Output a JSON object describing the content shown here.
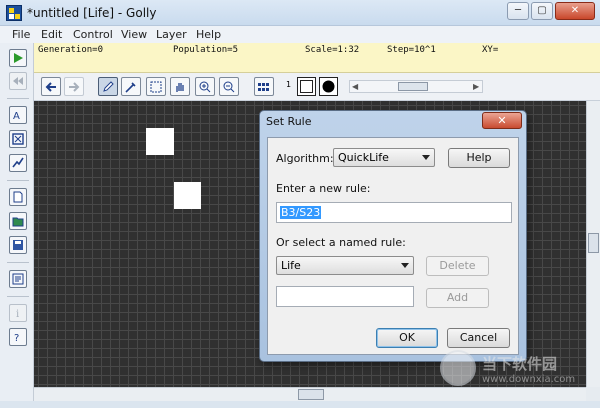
{
  "window": {
    "title": "*untitled [Life] - Golly",
    "caption_minimize": "─",
    "caption_maximize": "▢",
    "caption_close": "✕"
  },
  "menu": [
    "File",
    "Edit",
    "Control",
    "View",
    "Layer",
    "Help"
  ],
  "status": {
    "generation": "Generation=0",
    "population": "Population=5",
    "scale": "Scale=1:32",
    "step": "Step=10^1",
    "xy": "XY="
  },
  "toolbar": {
    "state_number": "1",
    "state0_color": "#ffffff",
    "state1_color": "#000000"
  },
  "left_toolbar_icons": [
    "play-icon",
    "rewind-icon",
    "algorithm-icon",
    "fit-icon",
    "info-icon",
    "new-pattern-icon",
    "open-pattern-icon",
    "save-pattern-icon",
    "open-clipboard-icon",
    "info-i-icon",
    "help-icon"
  ],
  "grid": {
    "background": "#303030",
    "live_cell_color": "#ffffff"
  },
  "dialog": {
    "title": "Set Rule",
    "close_label": "✕",
    "algorithm_label": "Algorithm:",
    "algorithm_value": "QuickLife",
    "help_label": "Help",
    "enter_rule_label": "Enter a new rule:",
    "rule_value": "B3/S23",
    "named_rule_label": "Or select a named rule:",
    "named_rule_value": "Life",
    "delete_label": "Delete",
    "new_name_value": "",
    "add_label": "Add",
    "ok_label": "OK",
    "cancel_label": "Cancel"
  },
  "watermark": {
    "text": "当下软件园",
    "url": "www.downxia.com"
  }
}
